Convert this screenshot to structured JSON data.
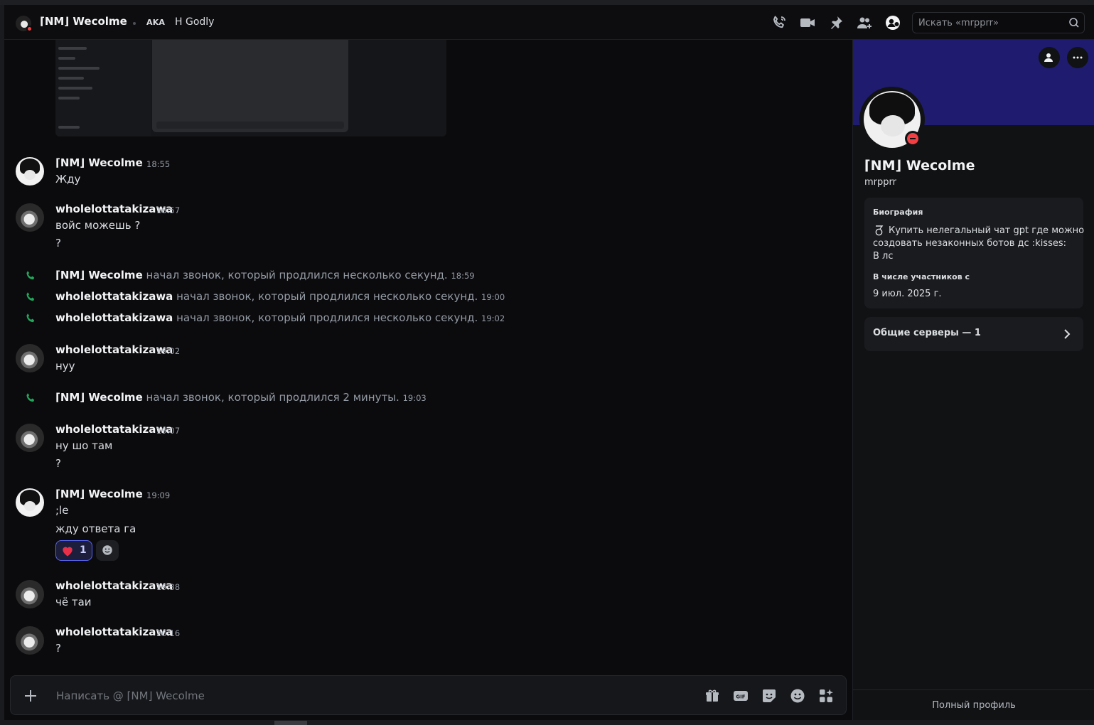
{
  "header": {
    "name": "⌈NM⌋ Wecolme",
    "aka_label": "AKA",
    "alias": "H Godly",
    "search_placeholder": "Искать «mrpprr»"
  },
  "messages": [
    {
      "author": "⌈NM⌋ Wecolme",
      "time": "18:55",
      "lines": [
        "Жду"
      ]
    },
    {
      "author": "wholelottatakizawa",
      "time": "18:57",
      "lines": [
        "войс можешь ?",
        "?"
      ]
    },
    {
      "author": "wholelottatakizawa",
      "time": "19:02",
      "lines": [
        "нуу"
      ]
    },
    {
      "author": "wholelottatakizawa",
      "time": "19:07",
      "lines": [
        "ну шо там",
        "?"
      ]
    },
    {
      "author": "⌈NM⌋ Wecolme",
      "time": "19:09",
      "lines": [
        ";le",
        "жду ответа га"
      ]
    },
    {
      "author": "wholelottatakizawa",
      "time": "19:38",
      "lines": [
        "чё таи"
      ]
    },
    {
      "author": "wholelottatakizawa",
      "time": "20:16",
      "lines": [
        "?"
      ]
    }
  ],
  "calls": [
    {
      "who": "⌈NM⌋ Wecolme",
      "text": "начал звонок, который продлился несколько секунд.",
      "time": "18:59"
    },
    {
      "who": "wholelottatakizawa",
      "text": "начал звонок, который продлился несколько секунд.",
      "time": "19:00"
    },
    {
      "who": "wholelottatakizawa",
      "text": "начал звонок, который продлился несколько секунд.",
      "time": "19:02"
    },
    {
      "who": "⌈NM⌋ Wecolme",
      "text": "начал звонок, который продлился 2 минуты.",
      "time": "19:03"
    }
  ],
  "reaction": {
    "emoji": "heart",
    "count": "1"
  },
  "composer": {
    "placeholder": "Написать @ ⌈NM⌋ Wecolme"
  },
  "profile": {
    "display_name": "⌈NM⌋ Wecolme",
    "username": "mrpprr",
    "bio_title": "Биография",
    "bio_line1": "Купить нелегальный чат gpt где можно",
    "bio_line2": "создовать  незаконных ботов дс :kisses:",
    "bio_line3": "В лс",
    "member_since_title": "В числе участников с",
    "member_since": "9 июл. 2025 г.",
    "mutual_servers": "Общие серверы — 1",
    "full_profile": "Полный профиль"
  },
  "colors": {
    "banner": "#1f1b6e",
    "call_green": "#23a55a",
    "dnd_red": "#f23f43",
    "reaction_border": "#5865f2"
  }
}
